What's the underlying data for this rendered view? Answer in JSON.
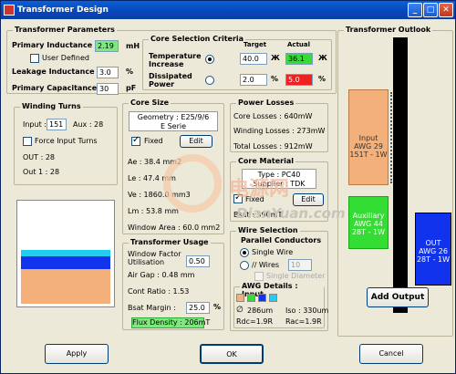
{
  "window": {
    "title": "Transformer Design"
  },
  "params": {
    "title": "Transformer Parameters",
    "primary_inductance_label": "Primary Inductance",
    "primary_inductance_value": "2.19",
    "primary_inductance_unit": "mH",
    "user_defined_label": "User Defined",
    "leakage_label": "Leakage Inductance",
    "leakage_value": "3.0",
    "leakage_unit": "%",
    "capacitance_label": "Primary Capacitance",
    "capacitance_value": "30",
    "capacitance_unit": "pF"
  },
  "core_sel": {
    "title": "Core Selection Criteria",
    "target_label": "Target",
    "actual_label": "Actual",
    "temp_label": "Temperature Increase",
    "temp_target": "40.0",
    "temp_actual": "36.1",
    "temp_unit_symbol": "Ж",
    "diss_label": "Dissipated Power",
    "diss_target": "2.0",
    "diss_actual": "5.0",
    "diss_unit": "%",
    "colors": {
      "ok": "#33dd33",
      "bad": "#ee2222"
    }
  },
  "winding": {
    "title": "Winding Turns",
    "input_label": "Input :",
    "input_value": "151",
    "aux_label": "Aux : 28",
    "force_label": "Force Input Turns",
    "out_label": "OUT : 28",
    "out1_label": "Out 1 : 28"
  },
  "core_size": {
    "title": "Core Size",
    "geometry": "Geometry : E25/9/6",
    "series": "E Serie",
    "fixed_label": "Fixed",
    "edit_label": "Edit",
    "ae": "Ae : 38.4 mm2",
    "le": "Le : 47.4 mm",
    "ve": "Ve : 1860.0 mm3",
    "lm": "Lm : 53.8 mm",
    "window_area": "Window Area : 60.0 mm2"
  },
  "usage": {
    "title": "Transformer Usage",
    "wf_label": "Window Factor Utilisation",
    "wf_value": "0.50",
    "airgap": "Air Gap : 0.48 mm",
    "cont": "Cont Ratio : 1.53",
    "bsat_label": "Bsat Margin :",
    "bsat_value": "25.0",
    "bsat_unit": "%",
    "flux": "Flux Density : 206mT"
  },
  "losses": {
    "title": "Power Losses",
    "core": "Core Losses : 640mW",
    "winding": "Winding Losses : 273mW",
    "total": "Total Losses : 912mW"
  },
  "material": {
    "title": "Core Material",
    "type": "Type : PC40",
    "supplier": "Supplier : TDK",
    "fixed_label": "Fixed",
    "edit_label": "Edit",
    "bsat": "Bsat : 390mT"
  },
  "wire": {
    "title": "Wire Selection",
    "parallel_label": "Parallel Conductors",
    "single_label": "Single Wire",
    "wires_label": "// Wires",
    "wires_value": "10",
    "single_diam_label": "Single Diameter"
  },
  "awg": {
    "title": "AWG Details : Input",
    "diam": "286um",
    "iso": "Iso : 330um",
    "rdc": "Rdc=1.9R",
    "rac": "Rac=1.9R",
    "swatches": [
      "#f4b07a",
      "#33dd33",
      "#1133ee",
      "#22ccee"
    ]
  },
  "outlook": {
    "title": "Transformer Outlook",
    "input_block": [
      "Input",
      "AWG 29",
      "151T - 1W"
    ],
    "aux_block": [
      "Auxiliary",
      "AWG 44",
      "28T - 1W"
    ],
    "out_block": [
      "OUT",
      "AWG 26",
      "28T - 1W"
    ],
    "add_output_label": "Add Output"
  },
  "footer": {
    "apply_label": "Apply",
    "ok_label": "OK",
    "cancel_label": "Cancel"
  },
  "watermark": {
    "brand_cn": "电源网",
    "brand_url": "DianYuan.com"
  }
}
